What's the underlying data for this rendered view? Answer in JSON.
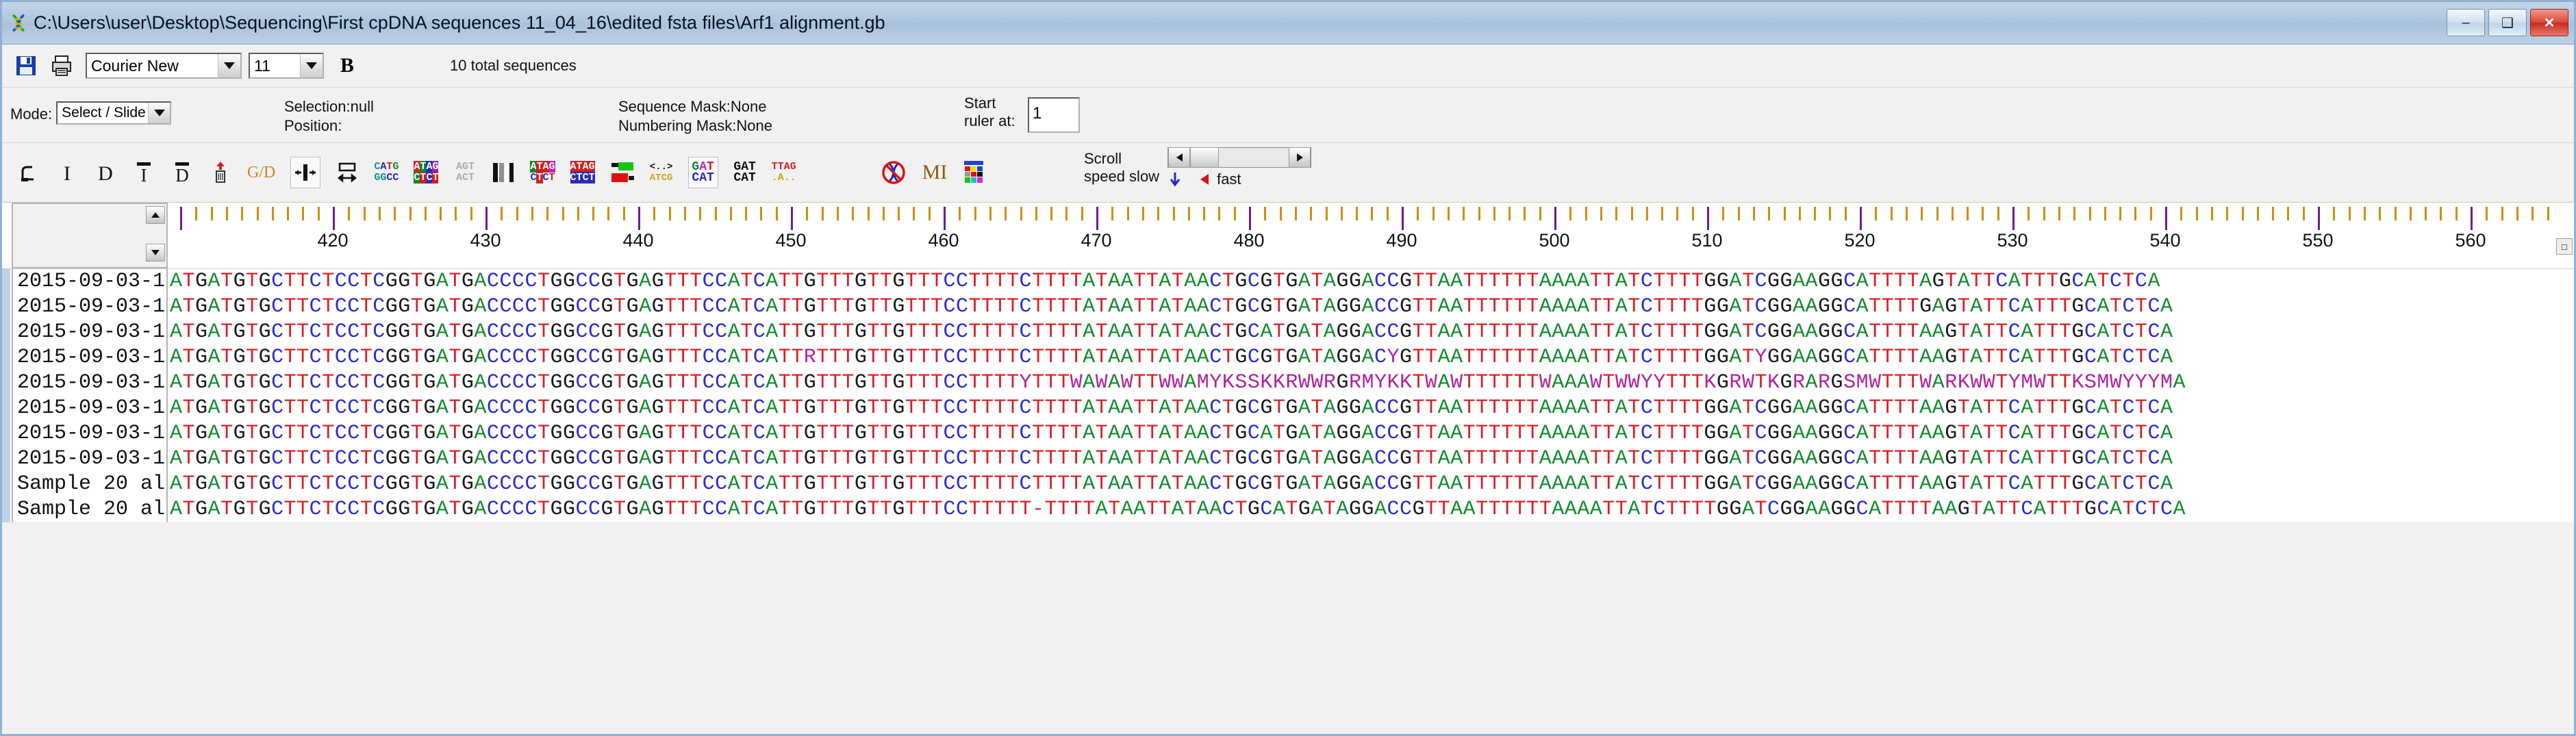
{
  "window": {
    "title": "C:\\Users\\user\\Desktop\\Sequencing\\First cpDNA sequences 11_04_16\\edited fsta files\\Arf1 alignment.gb",
    "app_icon": "dna-helix-icon",
    "minimize": "–",
    "maximize": "❑",
    "close": "✕"
  },
  "font_toolbar": {
    "save_icon": "save-disk-icon",
    "print_icon": "printer-icon",
    "font_family": "Courier New",
    "font_size": "11",
    "bold_label": "B",
    "total_sequences": "10 total sequences"
  },
  "mode_bar": {
    "mode_label": "Mode:",
    "mode_value": "Select / Slide",
    "selection_label": "Selection:null",
    "position_label": "Position:",
    "sequence_mask_label": "Sequence Mask:None",
    "numbering_mask_label": "Numbering Mask:None",
    "start_ruler_label_line1": "Start",
    "start_ruler_label_line2": "ruler at:",
    "start_ruler_value": "1"
  },
  "icon_toolbar": {
    "icons": [
      {
        "name": "select-slide-icon",
        "glyph": "⌐"
      },
      {
        "name": "insert-icon",
        "glyph": "I"
      },
      {
        "name": "delete-icon",
        "glyph": "D"
      },
      {
        "name": "insert-gap-icon",
        "glyph": "I"
      },
      {
        "name": "delete-gap-icon",
        "glyph": "D"
      },
      {
        "name": "trash-sequence-icon",
        "glyph": "♻"
      },
      {
        "name": "group-dissolve-icon",
        "glyph": "G/D"
      },
      {
        "name": "align-center-icon",
        "glyph": "+|+"
      },
      {
        "name": "measure-icon",
        "glyph": "↦"
      },
      {
        "name": "translate-icon",
        "glyph": "CATG"
      },
      {
        "name": "color-bases-icon",
        "glyph": "ATAG"
      },
      {
        "name": "shade-identity-icon",
        "glyph": "AGT"
      },
      {
        "name": "greyscale-icon",
        "glyph": "▐▌"
      },
      {
        "name": "highlight-differences-icon",
        "glyph": "ATAG"
      },
      {
        "name": "highlight-similar-icon",
        "glyph": "ATAG"
      },
      {
        "name": "block-colors-icon",
        "glyph": "■"
      },
      {
        "name": "consensus-icon",
        "glyph": "<..>"
      },
      {
        "name": "show-translation-icon",
        "glyph": "GAT"
      },
      {
        "name": "dot-plot-icon",
        "glyph": "GAT"
      },
      {
        "name": "mask-icon",
        "glyph": "TTAG"
      },
      {
        "name": "no-dna-icon",
        "glyph": "⊘"
      },
      {
        "name": "mi-icon",
        "glyph": "MI"
      },
      {
        "name": "color-palette-icon",
        "glyph": "▦"
      }
    ],
    "scroll_label_line1": "Scroll",
    "scroll_label_line2": "speed slow",
    "scroll_fast_label": "fast",
    "scroll_left_arrow": "◀",
    "scroll_right_arrow": "▶"
  },
  "ruler": {
    "tick_labels": [
      "420",
      "430",
      "440",
      "450",
      "460",
      "470",
      "480",
      "490",
      "500",
      "510",
      "520",
      "530",
      "540",
      "550",
      "560"
    ],
    "minor_tick_interval": 1,
    "major_tick_interval": 10,
    "scroll_up_arrow": "▲",
    "scroll_down_arrow": "▼",
    "end_button": "□"
  },
  "alignment": {
    "names": [
      "2015-09-03-1",
      "2015-09-03-1",
      "2015-09-03-1",
      "2015-09-03-1",
      "2015-09-03-1",
      "2015-09-03-1",
      "2015-09-03-1",
      "2015-09-03-1",
      "Sample 20 al",
      "Sample 20 al"
    ],
    "sequences": [
      "ATGATGTGCTTCTCCTCGGTGATGACCCCTGGCCGTGAGTTTCCATCATTGTTTGTTGTTTCCTTTTCTTTTATAATTATAACTGCGTGATAGGACCGTTAATTTTTTAAAATTATCTTTTGGATCGGAAGGCATTTTAGTATTCATTTGCATCTCA",
      "ATGATGTGCTTCTCCTCGGTGATGACCCCTGGCCGTGAGTTTCCATCATTGTTTGTTGTTTCCTTTTCTTTTATAATTATAACTGCGTGATAGGACCGTTAATTTTTTAAAATTATCTTTTGGATCGGAAGGCATTTTGAGTATTCATTTGCATCTCA",
      "ATGATGTGCTTCTCCTCGGTGATGACCCCTGGCCGTGAGTTTCCATCATTGTTTGTTGTTTCCTTTTCTTTTATAATTATAACTGCATGATAGGACCGTTAATTTTTTAAAATTATCTTTTGGATCGGAAGGCATTTTAAGTATTCATTTGCATCTCA",
      "ATGATGTGCTTCTCCTCGGTGATGACCCCTGGCCGTGAGTTTCCATCATTRTTTGTTGTTTCCTTTTCTTTTATAATTATAACTGCGTGATAGGACYGTTAATTTTTTAAAATTATCTTTTGGATYGGAAGGCATTTTAAGTATTCATTTGCATCTCA",
      "ATGATGTGCTTCTCCTCGGTGATGACCCCTGGCCGTGAGTTTCCATCATTGTTTGTTGTTTCCTTTTYTTTWAWAWTTWWAMYKSSKKRWWRGRMYKKTWAWTTTTTTWAAAWTWWYYTTTKGRWTKGRARGSMWTTTWARKWWTYMWTTKSMWYYYMA",
      "ATGATGTGCTTCTCCTCGGTGATGACCCCTGGCCGTGAGTTTCCATCATTGTTTGTTGTTTCCTTTTCTTTTATAATTATAACTGCGTGATAGGACCGTTAATTTTTTAAAATTATCTTTTGGATCGGAAGGCATTTTAAGTATTCATTTGCATCTCA",
      "ATGATGTGCTTCTCCTCGGTGATGACCCCTGGCCGTGAGTTTCCATCATTGTTTGTTGTTTCCTTTTCTTTTATAATTATAACTGCATGATAGGACCGTTAATTTTTTAAAATTATCTTTTGGATCGGAAGGCATTTTAAGTATTCATTTGCATCTCA",
      "ATGATGTGCTTCTCCTCGGTGATGACCCCTGGCCGTGAGTTTCCATCATTGTTTGTTGTTTCCTTTTCTTTTATAATTATAACTGCGTGATAGGACCGTTAATTTTTTAAAATTATCTTTTGGATCGGAAGGCATTTTAAGTATTCATTTGCATCTCA",
      "ATGATGTGCTTCTCCTCGGTGATGACCCCTGGCCGTGAGTTTCCATCATTGTTTGTTGTTTCCTTTTCTTTTATAATTATAACTGCGTGATAGGACCGTTAATTTTTTAAAATTATCTTTTGGATCGGAAGGCATTTTAAGTATTCATTTGCATCTCA",
      "ATGATGTGCTTCTCCTCGGTGATGACCCCTGGCCGTGAGTTTCCATCATTGTTTGTTGTTTCCTTTTT-TTTTATAATTATAACTGCATGATAGGACCGTTAATTTTTTAAAATTATCTTTTGGATCGGAAGGCATTTTAAGTATTCATTTGCATCTCA"
    ]
  },
  "colors": {
    "base_A": "#128a2e",
    "base_T": "#d81f26",
    "base_G": "#1a1a1a",
    "base_C": "#2c2cc8",
    "base_ambiguous": "#b2229c",
    "titlebar": "#aec6de",
    "toolbar_bg": "#f1f1f1"
  }
}
